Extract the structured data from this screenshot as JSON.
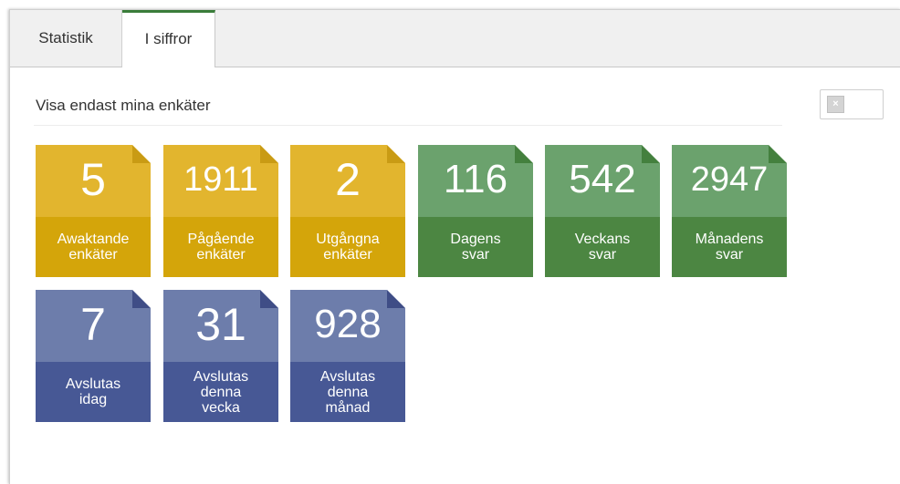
{
  "tabs": [
    {
      "label": "Statistik",
      "active": false
    },
    {
      "label": "I siffror",
      "active": true
    }
  ],
  "filter": {
    "label": "Visa endast mina enkäter",
    "toggle_on": false,
    "toggle_icon": "×"
  },
  "colors": {
    "yellow": "#d4a50a",
    "green": "#4c8642",
    "blue": "#475895",
    "active_tab_accent": "#3a7d3a"
  },
  "tiles": [
    {
      "value": "5",
      "label": "Awaktande\nenkäter"
    },
    {
      "value": "1911",
      "label": "Pågående\nenkäter"
    },
    {
      "value": "2",
      "label": "Utgångna\nenkäter"
    },
    {
      "value": "116",
      "label": "Dagens\nsvar"
    },
    {
      "value": "542",
      "label": "Veckans\nsvar"
    },
    {
      "value": "2947",
      "label": "Månadens\nsvar"
    },
    {
      "value": "7",
      "label": "Avslutas\nidag"
    },
    {
      "value": "31",
      "label": "Avslutas\ndenna\nvecka"
    },
    {
      "value": "928",
      "label": "Avslutas\ndenna\nmånad"
    }
  ]
}
